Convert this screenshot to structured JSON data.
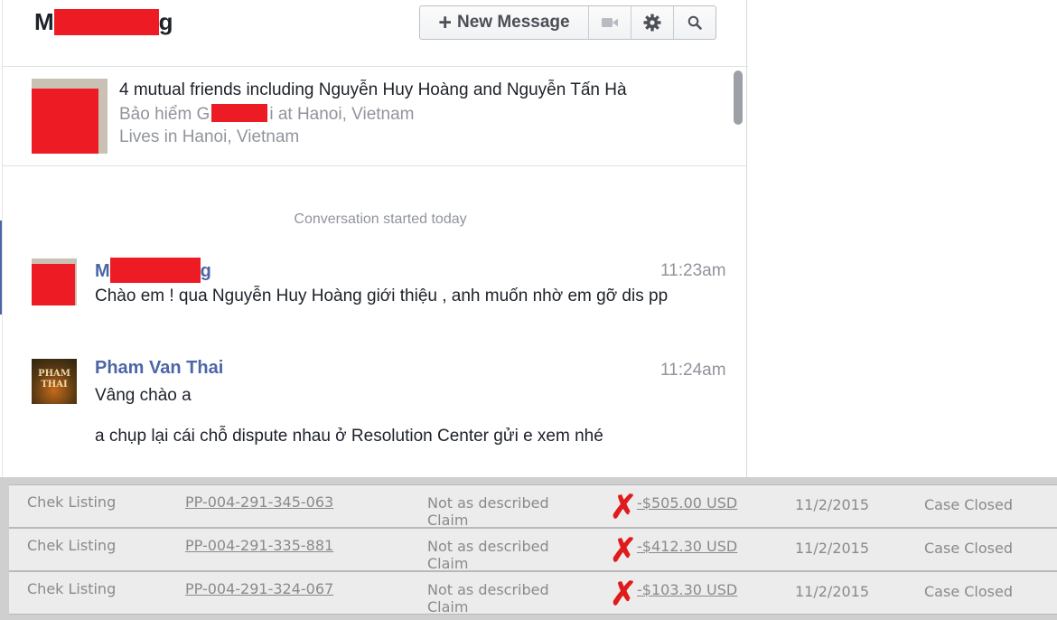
{
  "conversation": {
    "title_prefix": "M",
    "title_suffix": "g",
    "toolbar": {
      "new_message_label": "New Message",
      "icons": [
        "plus-icon",
        "video-camera-icon",
        "gear-icon",
        "search-icon"
      ]
    },
    "profile": {
      "mutual_friends": "4 mutual friends including Nguyễn Huy Hoàng and Nguyễn Tấn Hà",
      "work_prefix": "Bảo hiểm G",
      "work_suffix": "i at Hanoi, Vietnam",
      "lives_in": "Lives in Hanoi, Vietnam"
    },
    "started_label": "Conversation started today",
    "messages": [
      {
        "sender_prefix": "M",
        "sender_suffix": "g",
        "time": "11:23am",
        "text": "Chào em ! qua Nguyễn Huy Hoàng giới thiệu , anh muốn nhờ em gỡ dis pp"
      },
      {
        "sender": "Pham Van Thai",
        "time": "11:24am",
        "avatar_text": [
          "PHAM",
          "THAI"
        ],
        "lines": [
          "Vâng chào a",
          "a chụp lại cái chỗ dispute nhau ở Resolution Center  gửi e xem nhé"
        ]
      }
    ]
  },
  "transactions": [
    {
      "type": "Chek Listing",
      "id": "PP-004-291-345-063",
      "reason_line1": "Not as described",
      "reason_line2": "Claim",
      "mark": "✗",
      "amount": "-$505.00 USD",
      "date": "11/2/2015",
      "status": "Case Closed"
    },
    {
      "type": "Chek Listing",
      "id": "PP-004-291-335-881",
      "reason_line1": "Not as described",
      "reason_line2": "Claim",
      "mark": "✗",
      "amount": "-$412.30 USD",
      "date": "11/2/2015",
      "status": "Case Closed"
    },
    {
      "type": "Chek Listing",
      "id": "PP-004-291-324-067",
      "reason_line1": "Not as described",
      "reason_line2": "Claim",
      "mark": "✗",
      "amount": "-$103.30 USD",
      "date": "11/2/2015",
      "status": "Case Closed"
    }
  ],
  "colors": {
    "name_link": "#4b66a6",
    "redaction": "#ed1c24",
    "x_mark": "#e01b1b"
  }
}
